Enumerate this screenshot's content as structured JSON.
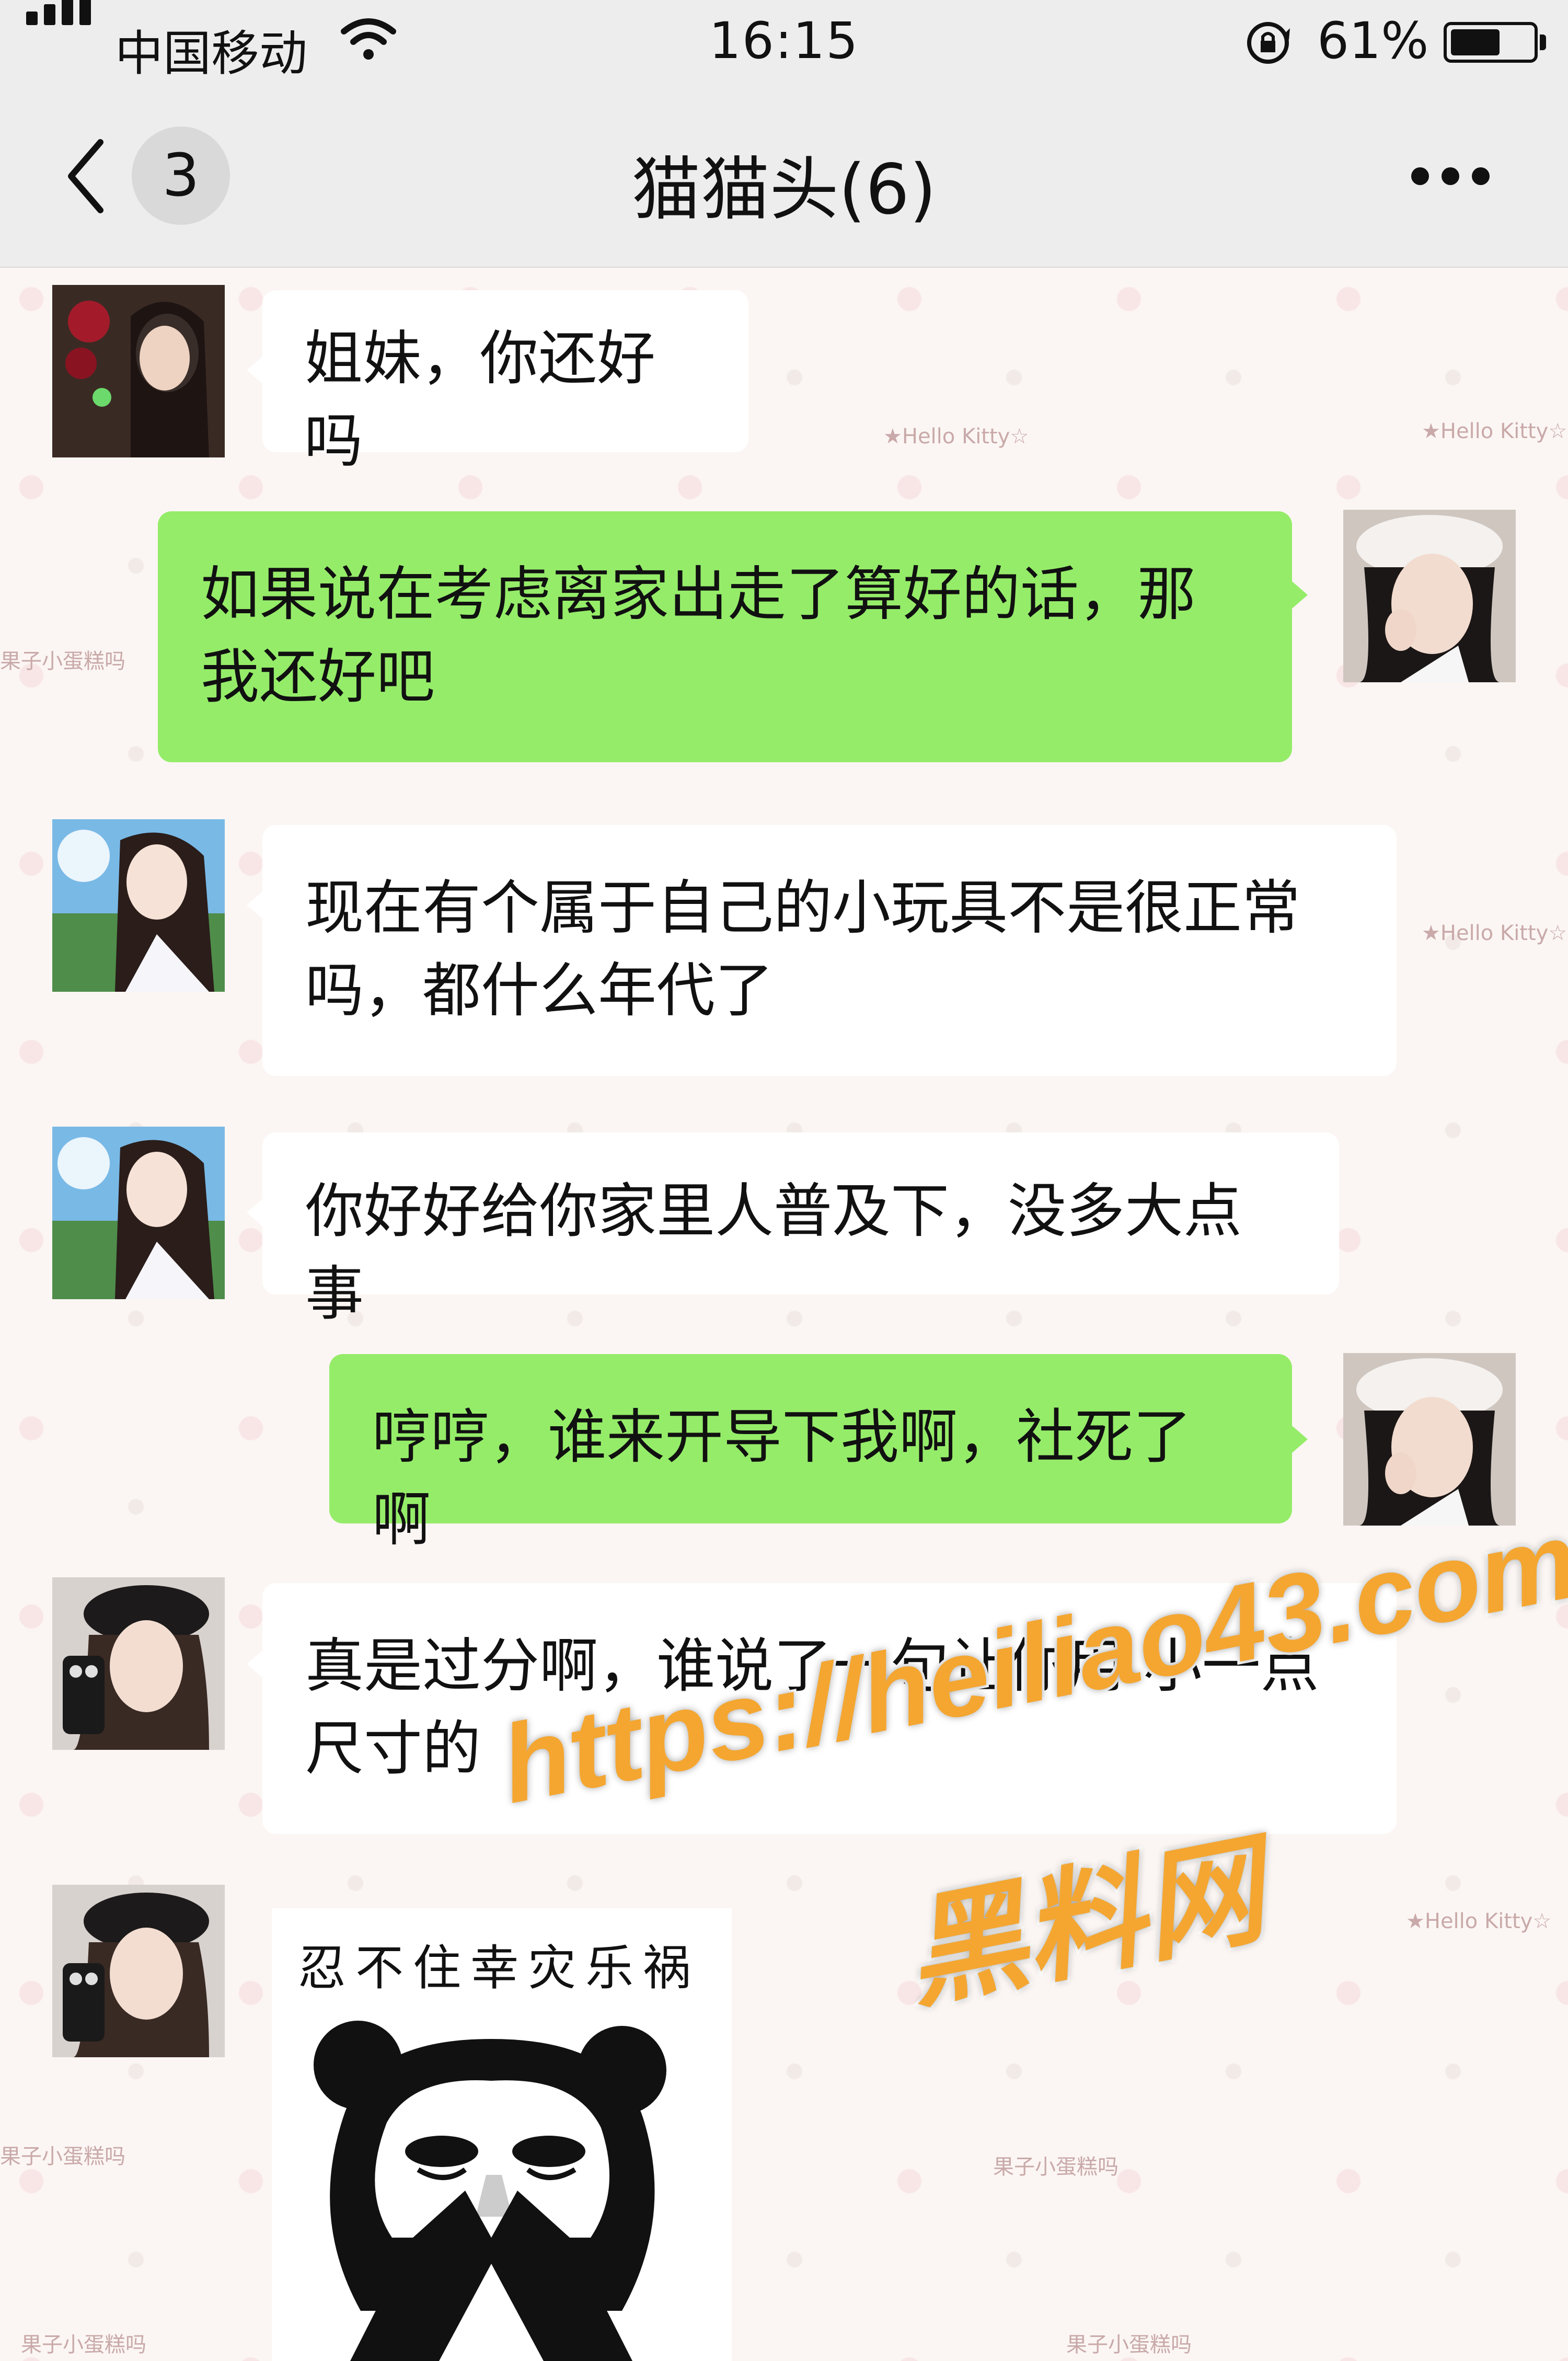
{
  "status_bar": {
    "carrier": "中国移动",
    "time": "16:15",
    "battery_percent": "61%",
    "battery_level": 0.61,
    "icons": [
      "signal-icon",
      "wifi-icon",
      "orientation-lock-icon",
      "battery-icon"
    ]
  },
  "nav": {
    "back_icon": "chevron-left-icon",
    "unread_count": "3",
    "title": "猫猫头(6)",
    "more_icon": "more-dots-icon"
  },
  "messages": [
    {
      "side": "in",
      "sender_avatar": "avatar-girl-roses",
      "lines": [
        "姐妹，你还好吗"
      ]
    },
    {
      "side": "out",
      "sender_avatar": "avatar-self-white-beret",
      "lines": [
        "如果说在考虑离家出走了算好的话，那",
        "我还好吧"
      ]
    },
    {
      "side": "in",
      "sender_avatar": "avatar-anime-girl",
      "lines": [
        "现在有个属于自己的小玩具不是很正常",
        "吗，都什么年代了"
      ]
    },
    {
      "side": "in",
      "sender_avatar": "avatar-anime-girl",
      "lines": [
        "你好好给你家里人普及下，没多大点事"
      ]
    },
    {
      "side": "out",
      "sender_avatar": "avatar-self-white-beret",
      "lines": [
        "哼哼，谁来开导下我啊，社死了啊"
      ]
    },
    {
      "side": "in",
      "sender_avatar": "avatar-girl-black-beret",
      "lines": [
        "真是过分啊，谁说了一句让你用 小一点",
        "尺寸的"
      ]
    },
    {
      "side": "in",
      "sender_avatar": "avatar-girl-black-beret",
      "sticker": {
        "caption": "忍不住幸灾乐祸",
        "image": "panda-meme-sticker"
      }
    }
  ],
  "background_marks": [
    "★Hello Kitty☆",
    "★Hello Kitty☆",
    "★Hello Kitty☆",
    "★Hello Kitty☆",
    "果子小蛋糕吗",
    "果子小蛋糕吗",
    "果子小蛋糕吗",
    "果子小蛋糕吗",
    "果子小蛋糕吗"
  ],
  "watermark": {
    "url": "https://heiliao43.com",
    "site_name": "黑料网"
  },
  "colors": {
    "outgoing_bubble": "#95ec69",
    "incoming_bubble": "#ffffff",
    "header_bg": "#ededed",
    "watermark": "#f4a631"
  }
}
